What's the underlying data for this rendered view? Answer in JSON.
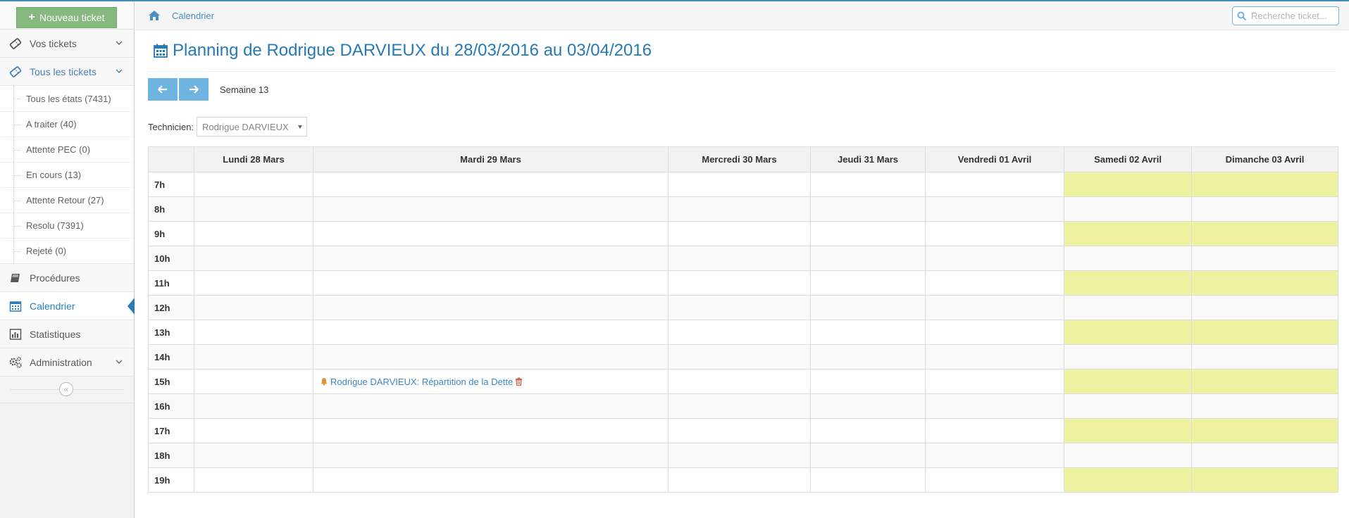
{
  "sidebar": {
    "new_ticket_label": "Nouveau ticket",
    "nav": {
      "vos_tickets": "Vos tickets",
      "tous_les_tickets": "Tous les tickets",
      "procedures": "Procédures",
      "calendrier": "Calendrier",
      "statistiques": "Statistiques",
      "administration": "Administration"
    },
    "submenu": [
      "Tous les états (7431)",
      "A traiter (40)",
      "Attente PEC (0)",
      "En cours (13)",
      "Attente Retour (27)",
      "Resolu (7391)",
      "Rejeté (0)"
    ]
  },
  "breadcrumb": {
    "current": "Calendrier"
  },
  "search": {
    "placeholder": "Recherche ticket..."
  },
  "page": {
    "title": "Planning de Rodrigue DARVIEUX du 28/03/2016 au 03/04/2016",
    "week_label": "Semaine 13",
    "technician_label": "Technicien:",
    "technician_value": "Rodrigue DARVIEUX"
  },
  "planning": {
    "days": [
      "Lundi 28 Mars",
      "Mardi 29 Mars",
      "Mercredi 30 Mars",
      "Jeudi 31 Mars",
      "Vendredi 01 Avril",
      "Samedi 02 Avril",
      "Dimanche 03 Avril"
    ],
    "hours": [
      "7h",
      "8h",
      "9h",
      "10h",
      "11h",
      "12h",
      "13h",
      "14h",
      "15h",
      "16h",
      "17h",
      "18h",
      "19h"
    ],
    "event": {
      "label": "Rodrigue DARVIEUX: Répartition de la Dette"
    }
  },
  "colors": {
    "accent": "#2679b5",
    "new_ticket_bg": "#87b87f",
    "nav_button_bg": "#6fb3e0",
    "weekend_highlight": "#eff2a0",
    "event_icon": "#e8912d",
    "trash_icon": "#d15b47"
  },
  "icons": {
    "home": "home-icon",
    "search": "search-icon",
    "calendar": "calendar-icon",
    "prev": "arrow-left-icon",
    "next": "arrow-right-icon",
    "event": "bell-icon",
    "delete": "trash-icon"
  }
}
